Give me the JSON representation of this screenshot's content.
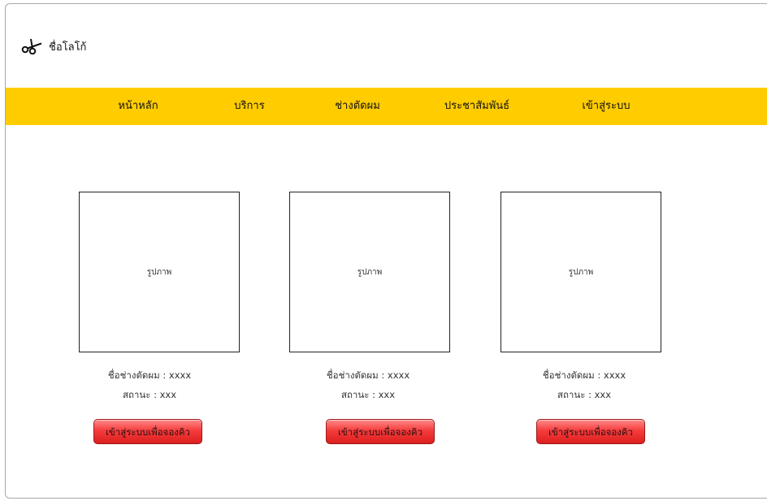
{
  "header": {
    "logo_icon": "scissors-icon",
    "logo_text": "ชื่อโลโก้"
  },
  "nav": {
    "background": "#ffcc00",
    "items": [
      {
        "label": "หน้าหลัก"
      },
      {
        "label": "บริการ"
      },
      {
        "label": "ช่างตัดผม"
      },
      {
        "label": "ประชาสัมพันธ์"
      },
      {
        "label": "เข้าสู่ระบบ"
      }
    ]
  },
  "cards": [
    {
      "image_label": "รูปภาพ",
      "name_line": "ชื่อช่างตัดผม : xxxx",
      "status_line": "สถานะ : xxx",
      "button_label": "เข้าสู่ระบบเพื่อจองคิว"
    },
    {
      "image_label": "รูปภาพ",
      "name_line": "ชื่อช่างตัดผม : xxxx",
      "status_line": "สถานะ : xxx",
      "button_label": "เข้าสู่ระบบเพื่อจองคิว"
    },
    {
      "image_label": "รูปภาพ",
      "name_line": "ชื่อช่างตัดผม : xxxx",
      "status_line": "สถานะ : xxx",
      "button_label": "เข้าสู่ระบบเพื่อจองคิว"
    }
  ],
  "colors": {
    "button": "#e82a2a",
    "button_border": "#9a1a1a"
  }
}
